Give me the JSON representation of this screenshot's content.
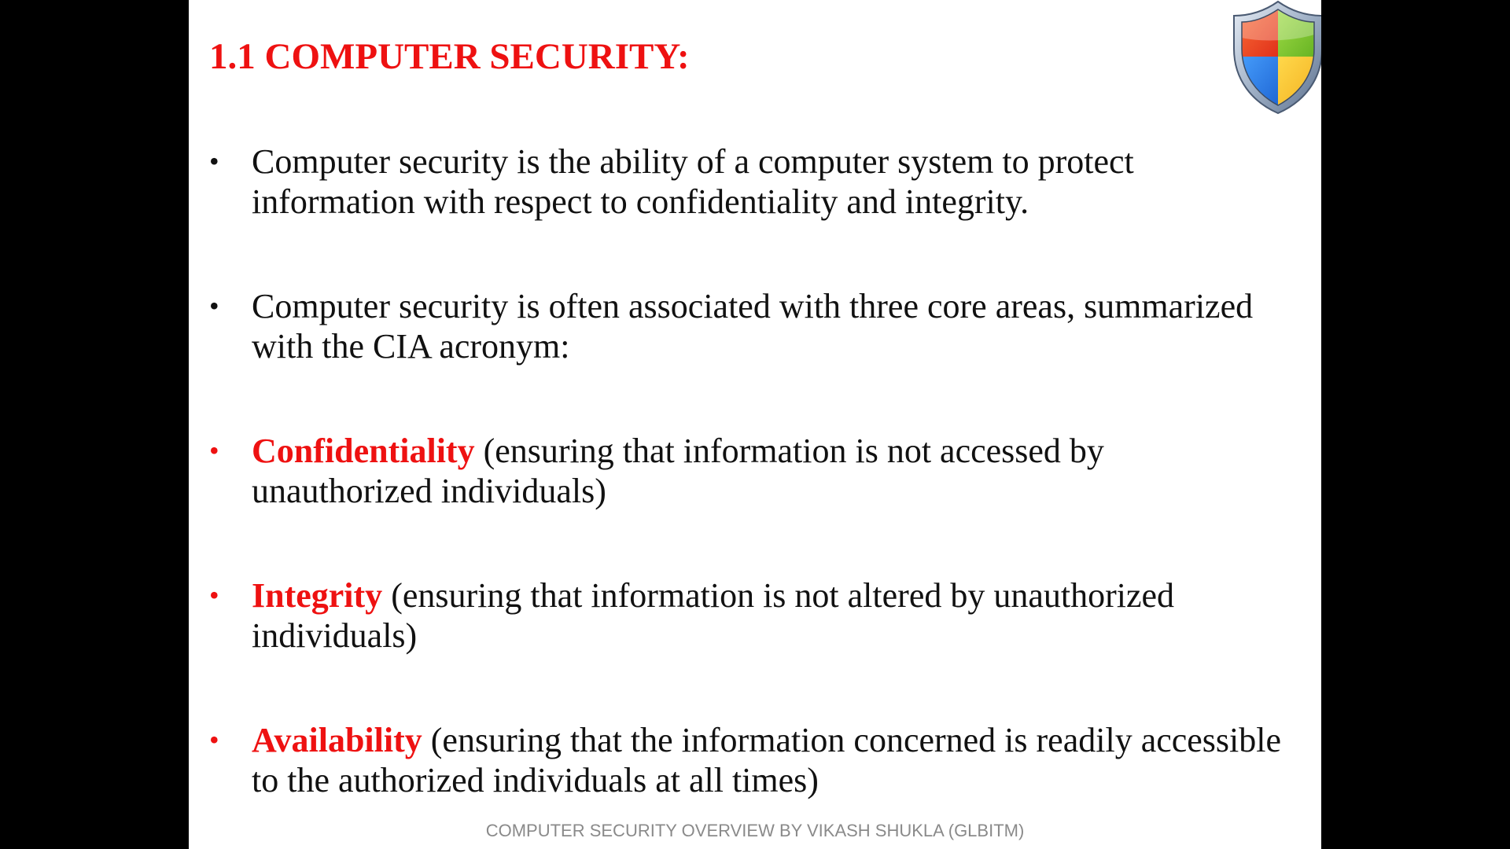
{
  "slide": {
    "title": "1.1 COMPUTER SECURITY:",
    "logo_icon": "security-shield-icon",
    "bullet_glyph": "•",
    "bullets": [
      {
        "keyword": "",
        "text": "Computer security is the ability of a computer system to protect information with respect to confidentiality and integrity."
      },
      {
        "keyword": "",
        "text": "Computer security is often associated with three core areas, summarized with the CIA acronym:"
      },
      {
        "keyword": "Confidentiality",
        "text": " (ensuring that information is not accessed by unauthorized individuals)"
      },
      {
        "keyword": "Integrity",
        "text": " (ensuring that information is not altered by unauthorized individuals)"
      },
      {
        "keyword": "Availability",
        "text": " (ensuring that the information concerned is readily accessible to the authorized individuals at all times)"
      }
    ],
    "footer": "COMPUTER SECURITY OVERVIEW BY VIKASH SHUKLA (GLBITM)"
  },
  "colors": {
    "title": "#ee1111",
    "keyword": "#ee1111",
    "body_text": "#111111",
    "footer_text": "#8a8a8a",
    "background": "#ffffff",
    "letterbox": "#000000"
  }
}
